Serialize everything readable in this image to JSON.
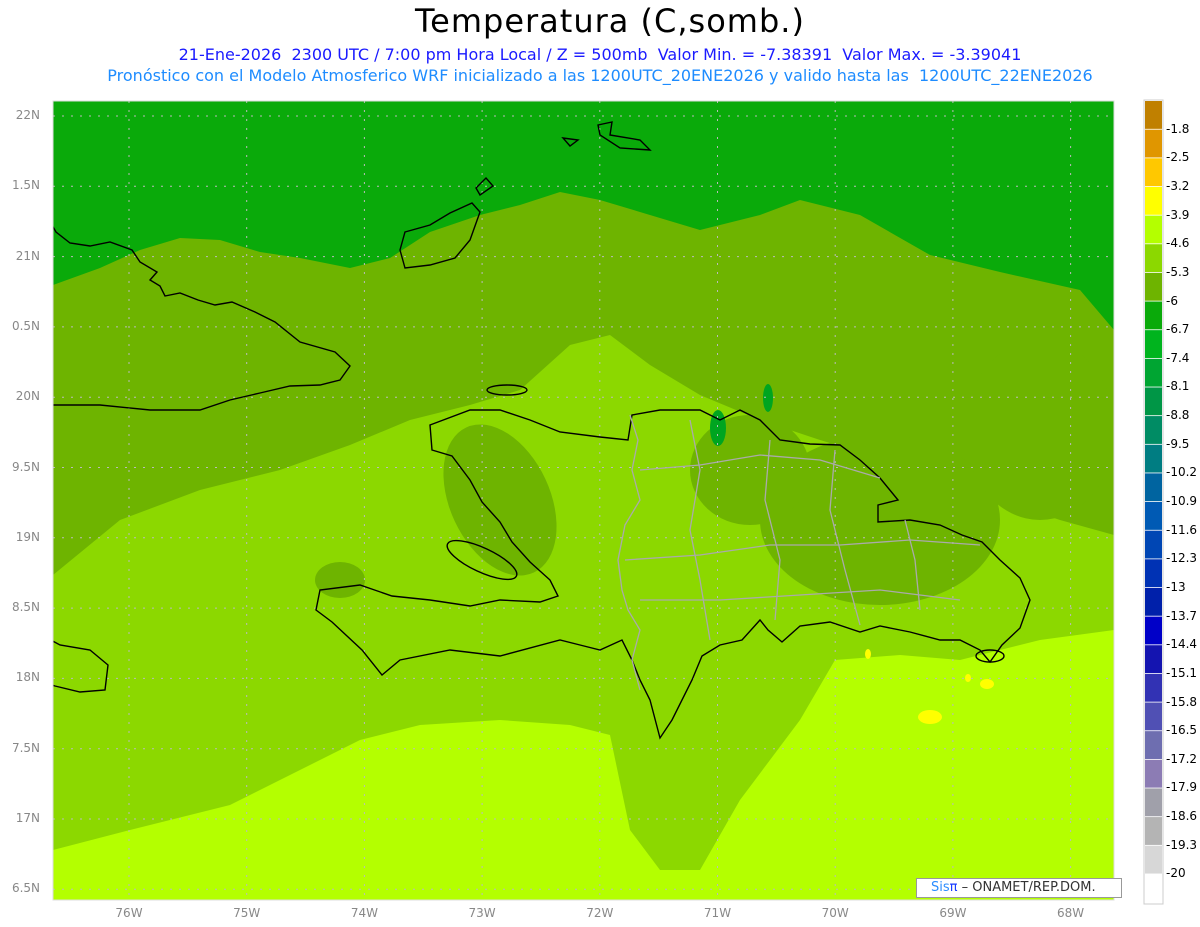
{
  "header": {
    "title": "Temperatura (C,somb.)",
    "line1": "21-Ene-2026  2300 UTC / 7:00 pm Hora Local / Z = 500mb  Valor Min. = -7.38391  Valor Max. = -3.39041",
    "line2": "Pronóstico con el Modelo Atmosferico WRF inicializado a las 1200UTC_20ENE2026 y valido hasta las  1200UTC_22ENE2026"
  },
  "map": {
    "lat_labels": [
      "22N",
      "1.5N",
      "21N",
      "0.5N",
      "20N",
      "9.5N",
      "19N",
      "8.5N",
      "18N",
      "7.5N",
      "17N",
      "6.5N"
    ],
    "lon_labels": [
      "76W",
      "75W",
      "74W",
      "73W",
      "72W",
      "71W",
      "70W",
      "69W",
      "68W"
    ],
    "field_colors": {
      "dark_green": "#0aaa0a",
      "olive": "#6eb400",
      "lime": "#8cd800",
      "light_lime": "#b4ff00",
      "yellow": "#ffff00"
    }
  },
  "colorbar": {
    "labels": [
      "-1.8",
      "-2.5",
      "-3.2",
      "-3.9",
      "-4.6",
      "-5.3",
      "-6",
      "-6.7",
      "-7.4",
      "-8.1",
      "-8.8",
      "-9.5",
      "-10.2",
      "-10.9",
      "-11.6",
      "-12.3",
      "-13",
      "-13.7",
      "-14.4",
      "-15.1",
      "-15.8",
      "-16.5",
      "-17.2",
      "-17.9",
      "-18.6",
      "-19.3",
      "-20"
    ],
    "colors": [
      "#c08000",
      "#e09600",
      "#ffc800",
      "#ffff00",
      "#b4ff00",
      "#8cd800",
      "#6eb400",
      "#0aaa0a",
      "#00b41e",
      "#00a532",
      "#009646",
      "#008c64",
      "#007d82",
      "#0064a0",
      "#005ab4",
      "#0046b4",
      "#0032b4",
      "#0020aa",
      "#0000c8",
      "#1414b0",
      "#3232b4",
      "#5050b4",
      "#6e6eb0",
      "#8c7cb4",
      "#a0a0aa",
      "#b4b4b4",
      "#d7d7d7",
      "#ffffff"
    ]
  },
  "credit": {
    "sis": "Sis",
    "pi": "π",
    "org": " – ONAMET/REP.DOM."
  }
}
